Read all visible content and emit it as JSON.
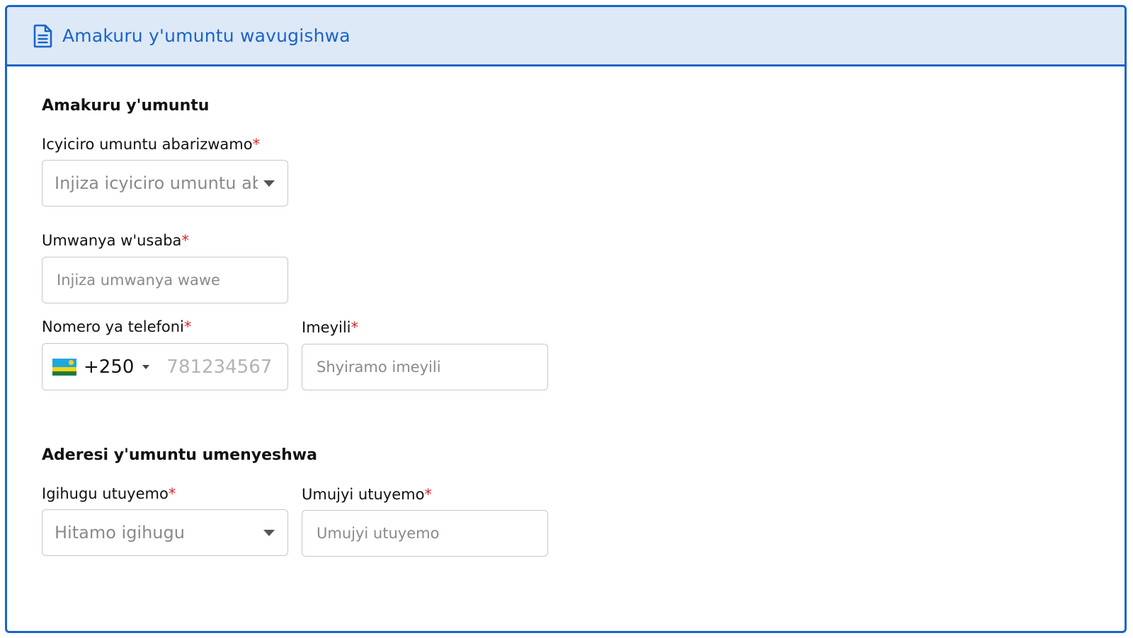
{
  "header": {
    "title": "Amakuru y'umuntu wavugishwa",
    "icon": "document-icon",
    "accent_color": "#1a64c8",
    "background_color": "#dde9f7"
  },
  "personal_section": {
    "title": "Amakuru y'umuntu",
    "fields": {
      "contact_level": {
        "label": "Icyiciro umuntu abarizwamo",
        "required_mark": "*",
        "placeholder": "Injiza icyiciro umuntu ab"
      },
      "position": {
        "label": "Umwanya w'usaba",
        "required_mark": "*",
        "placeholder": "Injiza umwanya wawe"
      },
      "phone": {
        "label": "Nomero ya telefoni",
        "required_mark": "*",
        "country_code": "+250",
        "flag_icon": "rwanda-flag-icon",
        "placeholder": "781234567"
      },
      "email": {
        "label": "Imeyili",
        "required_mark": "*",
        "placeholder": "Shyiramo imeyili"
      }
    }
  },
  "address_section": {
    "title": "Aderesi y'umuntu umenyeshwa",
    "fields": {
      "country": {
        "label": "Igihugu utuyemo",
        "required_mark": "*",
        "placeholder": "Hitamo igihugu"
      },
      "city": {
        "label": "Umujyi utuyemo",
        "required_mark": "*",
        "placeholder": "Umujyi utuyemo"
      }
    }
  },
  "required_color": "#e02424"
}
